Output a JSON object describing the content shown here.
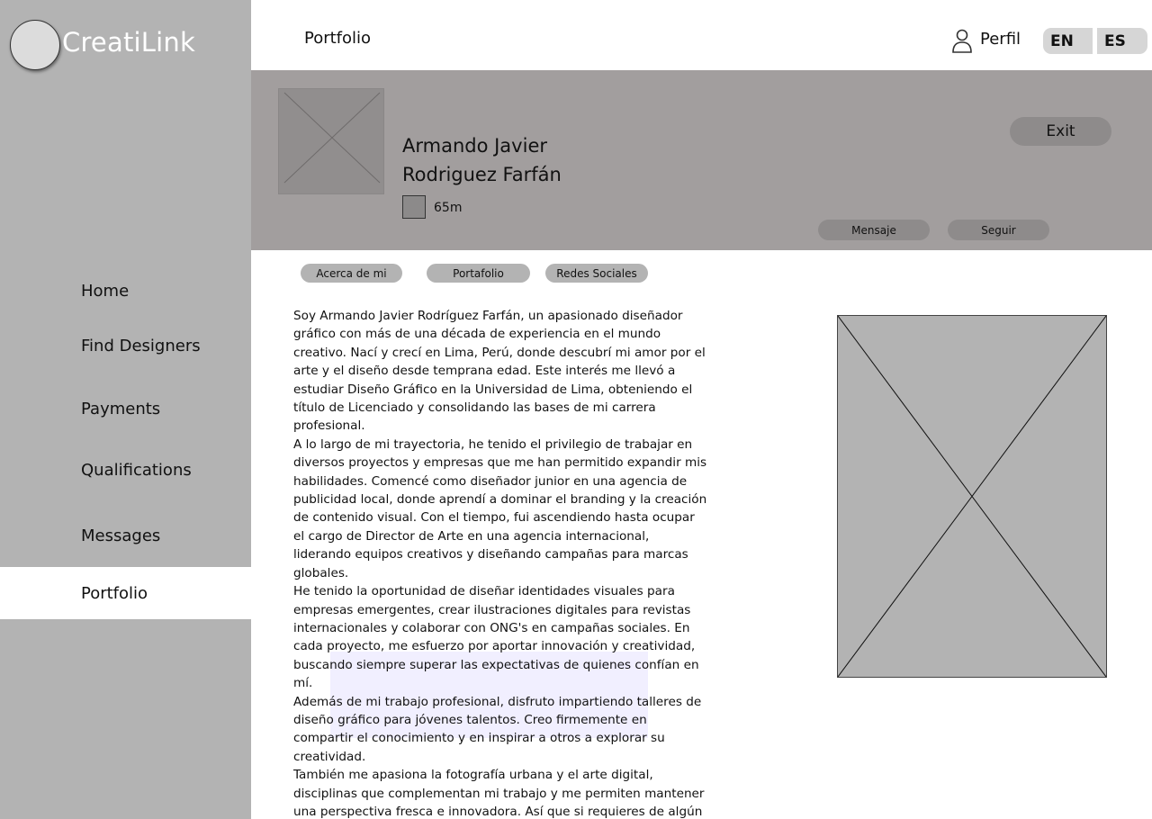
{
  "app": {
    "logo_text": "CreatiLink"
  },
  "sidebar": {
    "items": [
      {
        "label": "Home"
      },
      {
        "label": "Find Designers"
      },
      {
        "label": "Payments"
      },
      {
        "label": "Qualifications"
      },
      {
        "label": "Messages"
      },
      {
        "label": "Portfolio",
        "active": true
      }
    ]
  },
  "topbar": {
    "title": "Portfolio",
    "profile_label": "Perfil",
    "languages": [
      "EN",
      "ES"
    ]
  },
  "profile": {
    "name_line1": "Armando Javier",
    "name_line2": "Rodriguez Farfán",
    "badge_text": "65m",
    "exit_label": "Exit",
    "message_label": "Mensaje",
    "follow_label": "Seguir"
  },
  "tabs": [
    {
      "label": "Acerca de mi"
    },
    {
      "label": "Portafolio"
    },
    {
      "label": "Redes Sociales"
    }
  ],
  "bio": {
    "paragraphs": [
      "Soy Armando Javier Rodríguez Farfán, un apasionado diseñador gráfico con más de una década de experiencia en el mundo creativo. Nací y crecí en Lima, Perú, donde descubrí mi amor por el arte y el diseño desde temprana edad. Este interés me llevó a estudiar Diseño Gráfico en la Universidad de Lima, obteniendo el título de Licenciado y consolidando las bases de mi carrera profesional.",
      "A lo largo de mi trayectoria, he tenido el privilegio de trabajar en diversos proyectos y empresas que me han permitido expandir mis habilidades. Comencé como diseñador junior en una agencia de publicidad local, donde aprendí a dominar el branding y la creación de contenido visual. Con el tiempo, fui ascendiendo hasta ocupar el cargo de Director de Arte en una agencia internacional, liderando equipos creativos y diseñando campañas para marcas globales.",
      "He tenido la oportunidad de diseñar identidades visuales para empresas emergentes, crear ilustraciones digitales para revistas internacionales y colaborar con ONG's en campañas sociales. En cada proyecto, me esfuerzo por aportar innovación y creatividad, buscando siempre superar las expectativas de quienes confían en mí.",
      "Además de mi trabajo profesional, disfruto impartiendo talleres de diseño gráfico para jóvenes talentos. Creo firmemente en compartir el conocimiento y en inspirar a otros a explorar su creatividad.",
      "También me apasiona la fotografía urbana y el arte digital, disciplinas que complementan mi trabajo y me permiten mantener una perspectiva fresca e innovadora. Así que si requieres de algún trabajo referente al diseño, no dudes en escribirme:)"
    ]
  },
  "icons": {
    "profile": "user-icon"
  },
  "colors": {
    "sidebar": "#b3b3b3",
    "header": "#a29e9e",
    "active_nav": "#ffffff"
  }
}
